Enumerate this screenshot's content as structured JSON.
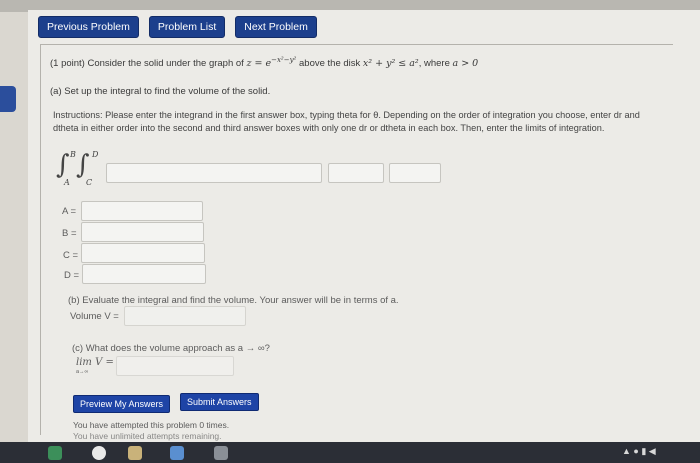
{
  "nav": {
    "previous": "Previous Problem",
    "list": "Problem List",
    "next": "Next Problem"
  },
  "problem": {
    "intro_prefix": "(1 point) Consider the solid under the graph of",
    "surface": "z = e",
    "surface_exp": "−x²−y²",
    "intro_mid": "above the disk",
    "disk": "x² + y² ≤ a²",
    "intro_mid2": ", where",
    "condition": "a > 0",
    "part_a": "(a) Set up the integral to find the volume of the solid.",
    "instructions": "Instructions: Please enter the integrand in the first answer box, typing theta for θ. Depending on the order of integration you choose, enter dr and dtheta in either order into the second and third answer boxes with only one dr or dtheta in each box. Then, enter the limits of integration.",
    "integral": {
      "outer_upper": "B",
      "outer_lower": "A",
      "inner_upper": "D",
      "inner_lower": "C"
    },
    "limits": [
      {
        "label": "A ="
      },
      {
        "label": "B ="
      },
      {
        "label": "C ="
      },
      {
        "label": "D ="
      }
    ],
    "part_b": "(b) Evaluate the integral and find the volume. Your answer will be in terms of a.",
    "volume_label": "Volume V =",
    "part_c": "(c) What does the volume approach as a → ∞?",
    "lim_label": "lim",
    "lim_sub": "a→∞",
    "lim_var": "V =",
    "preview_button": "Preview My Answers",
    "submit_button": "Submit Answers",
    "attempts_line1": "You have attempted this problem 0 times.",
    "attempts_line2": "You have unlimited attempts remaining."
  },
  "colors": {
    "nav_button": "#1c3f8c",
    "action_button": "#1e44a6",
    "page_bg": "#ecebe7"
  }
}
